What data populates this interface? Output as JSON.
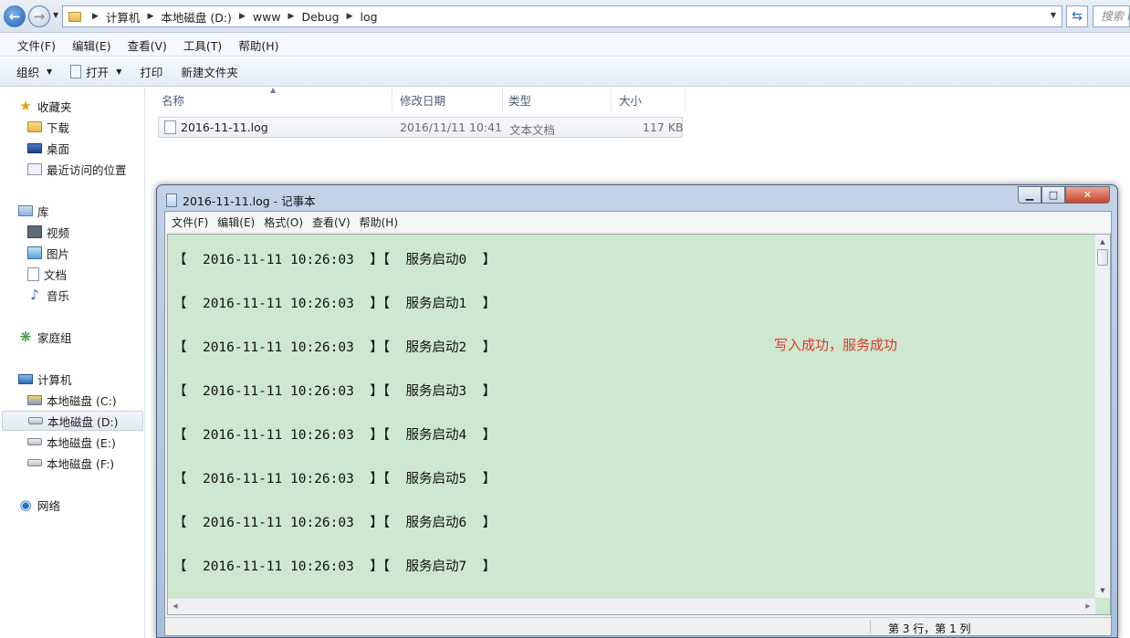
{
  "explorer": {
    "breadcrumb": [
      "计算机",
      "本地磁盘 (D:)",
      "www",
      "Debug",
      "log"
    ],
    "search_placeholder": "搜索 log",
    "menu": [
      "文件(F)",
      "编辑(E)",
      "查看(V)",
      "工具(T)",
      "帮助(H)"
    ],
    "toolbar": {
      "organize": "组织",
      "open": "打开",
      "print": "打印",
      "new_folder": "新建文件夹"
    },
    "nav": {
      "favorites": "收藏夹",
      "downloads": "下载",
      "desktop": "桌面",
      "recent": "最近访问的位置",
      "libraries": "库",
      "videos": "视频",
      "pictures": "图片",
      "documents": "文档",
      "music": "音乐",
      "homegroup": "家庭组",
      "computer": "计算机",
      "drive_c": "本地磁盘 (C:)",
      "drive_d": "本地磁盘 (D:)",
      "drive_e": "本地磁盘 (E:)",
      "drive_f": "本地磁盘 (F:)",
      "network": "网络"
    },
    "columns": {
      "name": "名称",
      "modified": "修改日期",
      "type": "类型",
      "size": "大小"
    },
    "files": [
      {
        "name": "2016-11-11.log",
        "modified": "2016/11/11 10:41",
        "type": "文本文档",
        "size": "117 KB"
      }
    ]
  },
  "notepad": {
    "title": "2016-11-11.log - 记事本",
    "menu": [
      "文件(F)",
      "编辑(E)",
      "格式(O)",
      "查看(V)",
      "帮助(H)"
    ],
    "lines": [
      "【  2016-11-11 10:26:03  】【  服务启动0  】",
      "【  2016-11-11 10:26:03  】【  服务启动1  】",
      "【  2016-11-11 10:26:03  】【  服务启动2  】",
      "【  2016-11-11 10:26:03  】【  服务启动3  】",
      "【  2016-11-11 10:26:03  】【  服务启动4  】",
      "【  2016-11-11 10:26:03  】【  服务启动5  】",
      "【  2016-11-11 10:26:03  】【  服务启动6  】",
      "【  2016-11-11 10:26:03  】【  服务启动7  】"
    ],
    "annotation": "写入成功，服务成功",
    "status": "第 3 行，第 1 列"
  }
}
